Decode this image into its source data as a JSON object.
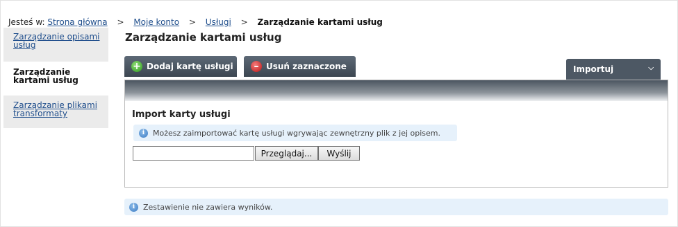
{
  "breadcrumb": {
    "prefix": "Jesteś w:",
    "items": [
      "Strona główna",
      "Moje konto",
      "Usługi"
    ],
    "separator": ">",
    "current": "Zarządzanie kartami usług"
  },
  "sidebar": {
    "items": [
      {
        "label": "Zarządzanie opisami usług",
        "active": false
      },
      {
        "label": "Zarządzanie kartami usług",
        "active": true
      },
      {
        "label": "Zarządzanie plikami transformaty",
        "active": false
      }
    ]
  },
  "page": {
    "title": "Zarządzanie kartami usług"
  },
  "toolbar": {
    "add_label": "Dodaj kartę usługi",
    "delete_label": "Usuń zaznaczone",
    "import_tab_label": "Importuj",
    "add_icon": "plus-icon",
    "delete_icon": "minus-icon",
    "import_icon": "chevron-down-icon"
  },
  "import_panel": {
    "title": "Import karty usługi",
    "info": "Możesz zaimportować kartę usługi wgrywając zewnętrzny plik z jej opisem.",
    "file_value": "",
    "browse_label": "Przeglądaj...",
    "send_label": "Wyślij"
  },
  "results": {
    "message": "Zestawienie nie zawiera wyników."
  },
  "colors": {
    "toolbar_button": "#4a5562",
    "info_background": "#e6f1fb",
    "link": "#1f4e8c",
    "sidebar_inactive": "#ebebeb"
  }
}
